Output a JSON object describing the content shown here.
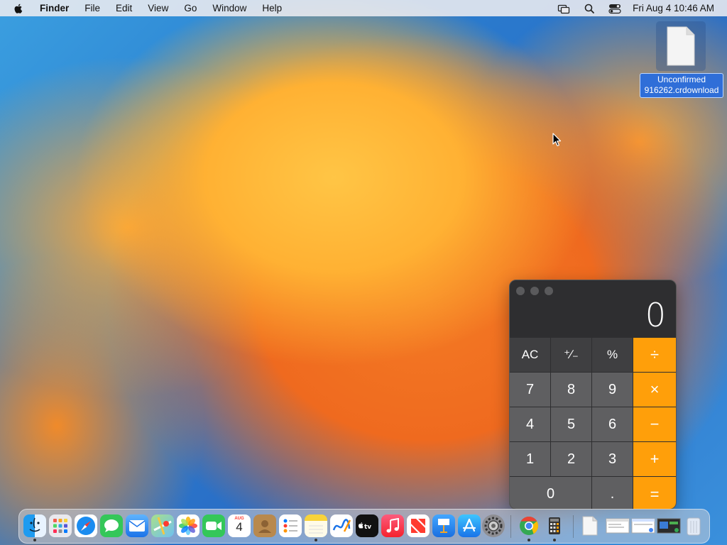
{
  "menubar": {
    "app_name": "Finder",
    "items": [
      "File",
      "Edit",
      "View",
      "Go",
      "Window",
      "Help"
    ],
    "clock": "Fri Aug 4  10:46 AM",
    "status_icons": [
      "screen-mirroring-icon",
      "spotlight-search-icon",
      "control-center-icon"
    ]
  },
  "desktop": {
    "file": {
      "name_line1": "Unconfirmed",
      "name_line2": "916262.crdownload",
      "icon": "document-icon"
    }
  },
  "calculator": {
    "display": "0",
    "keys": {
      "ac": "AC",
      "sign": "⁺∕₋",
      "percent": "%",
      "divide": "÷",
      "seven": "7",
      "eight": "8",
      "nine": "9",
      "multiply": "×",
      "four": "4",
      "five": "5",
      "six": "6",
      "minus": "−",
      "one": "1",
      "two": "2",
      "three": "3",
      "plus": "+",
      "zero": "0",
      "decimal": ".",
      "equals": "="
    },
    "colors": {
      "operator": "#ff9f0a",
      "function": "#3f3f41",
      "digit": "#5f5f61"
    }
  },
  "dock": {
    "calendar_month": "AUG",
    "calendar_day": "4",
    "apps": [
      "Finder",
      "Launchpad",
      "Safari",
      "Messages",
      "Mail",
      "Maps",
      "Photos",
      "FaceTime",
      "Calendar",
      "Contacts",
      "Reminders",
      "Notes",
      "Freeform",
      "TV",
      "Music",
      "News",
      "Keynote",
      "App Store",
      "System Settings",
      "Chrome",
      "Calculator",
      "Downloads",
      "Recent Window 1",
      "Recent Window 2",
      "Recent Window 3",
      "Trash"
    ]
  }
}
